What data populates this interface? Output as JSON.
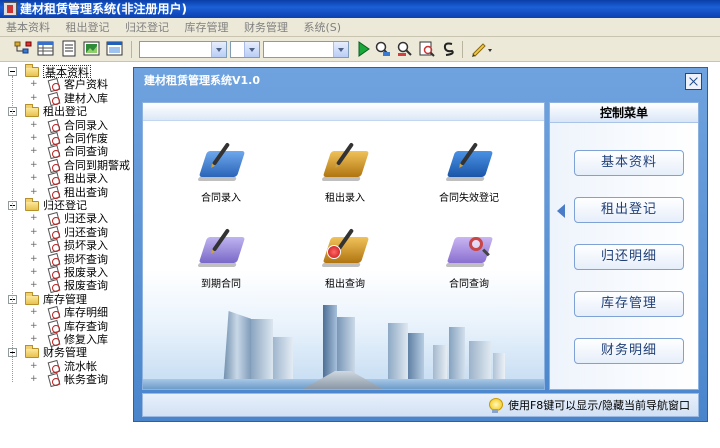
{
  "window": {
    "title": "建材租赁管理系统(非注册用户)"
  },
  "menu": [
    "基本资料",
    "租出登记",
    "归还登记",
    "库存管理",
    "财务管理",
    "系统(S)"
  ],
  "tree": [
    {
      "label": "基本资料",
      "children": [
        "客户资料",
        "建材入库"
      ]
    },
    {
      "label": "租出登记",
      "children": [
        "合同录入",
        "合同作废",
        "合同查询",
        "合同到期警戒",
        "租出录入",
        "租出查询"
      ]
    },
    {
      "label": "归还登记",
      "children": [
        "归还录入",
        "归还查询",
        "损坏录入",
        "损坏查询",
        "报废录入",
        "报废查询"
      ]
    },
    {
      "label": "库存管理",
      "children": [
        "库存明细",
        "库存查询",
        "修复入库"
      ]
    },
    {
      "label": "财务管理",
      "children": [
        "流水帐",
        "帐务查询"
      ]
    }
  ],
  "child_window": {
    "title": "建材租赁管理系统V1.0"
  },
  "functions": [
    {
      "label": "合同录入",
      "icon": "book-pen-icon",
      "color": "#3d7fd6"
    },
    {
      "label": "租出录入",
      "icon": "book-pen-icon",
      "color": "#c98b1c"
    },
    {
      "label": "合同失效登记",
      "icon": "book-pen-icon",
      "color": "#2870c4"
    },
    {
      "label": "到期合同",
      "icon": "book-pen-icon",
      "color": "#8a7ad6"
    },
    {
      "label": "租出查询",
      "icon": "book-badge-icon",
      "color": "#c98b1c"
    },
    {
      "label": "合同查询",
      "icon": "book-magnifier-icon",
      "color": "#9a80d8"
    }
  ],
  "control_menu": {
    "title": "控制菜单",
    "buttons": [
      "基本资料",
      "租出登记",
      "归还明细",
      "库存管理",
      "财务明细"
    ]
  },
  "status_hint": "使用F8键可以显示/隐藏当前导航窗口"
}
